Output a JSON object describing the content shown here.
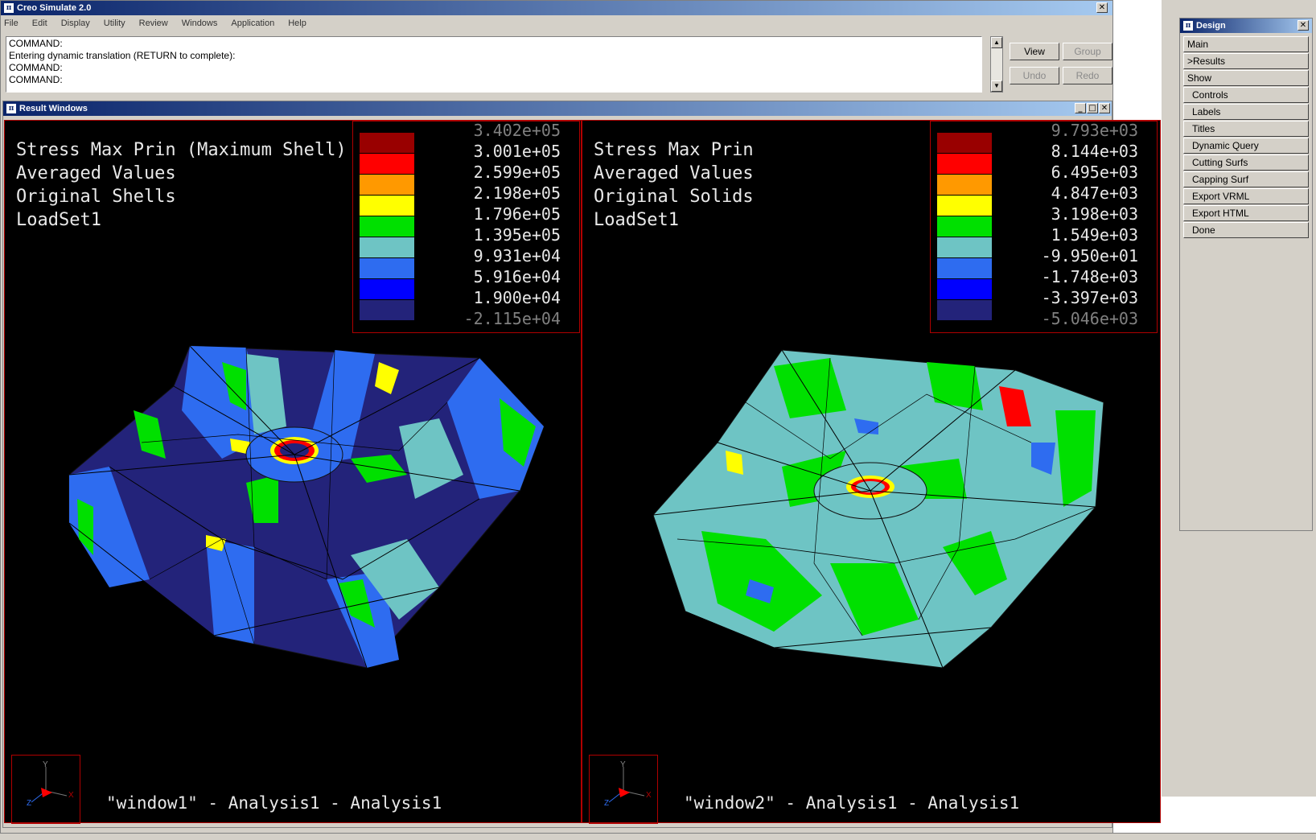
{
  "app": {
    "title": "Creo Simulate 2.0",
    "close_glyph": "✕"
  },
  "menu": [
    "File",
    "Edit",
    "Display",
    "Utility",
    "Review",
    "Windows",
    "Application",
    "Help"
  ],
  "command_lines": [
    "COMMAND:",
    "Entering dynamic translation (RETURN to complete):",
    "COMMAND:",
    "COMMAND:"
  ],
  "buttons": {
    "view": "View",
    "group": "Group",
    "undo": "Undo",
    "redo": "Redo"
  },
  "result_window": {
    "title": "Result Windows",
    "min_glyph": "_",
    "max_glyph": "□",
    "close_glyph": "✕"
  },
  "viewports": [
    {
      "labels": [
        "Stress Max Prin (Maximum Shell)",
        "Averaged Values",
        "Original Shells",
        "LoadSet1"
      ],
      "legend_values": [
        "3.402e+05",
        "3.001e+05",
        "2.599e+05",
        "2.198e+05",
        "1.796e+05",
        "1.395e+05",
        "9.931e+04",
        "5.916e+04",
        "1.900e+04",
        "-2.115e+04"
      ],
      "footer": "\"window1\" - Analysis1 - Analysis1",
      "axis_letters": {
        "y": "Y",
        "z": "Z",
        "x": "X"
      }
    },
    {
      "labels": [
        "Stress Max Prin",
        "Averaged Values",
        "Original Solids",
        "LoadSet1"
      ],
      "legend_values": [
        "9.793e+03",
        "8.144e+03",
        "6.495e+03",
        "4.847e+03",
        "3.198e+03",
        "1.549e+03",
        "-9.950e+01",
        "-1.748e+03",
        "-3.397e+03",
        "-5.046e+03"
      ],
      "footer": "\"window2\" - Analysis1 - Analysis1",
      "axis_letters": {
        "y": "Y",
        "z": "Z",
        "x": "X"
      }
    }
  ],
  "legend_colors": [
    "#990000",
    "#ff0000",
    "#ff9900",
    "#ffff00",
    "#00e000",
    "#6ec4c4",
    "#2e6cf0",
    "#0000ff",
    "#23237a"
  ],
  "design_panel": {
    "title": "Design",
    "close_glyph": "✕",
    "items": [
      "Main",
      ">Results",
      "Show",
      "Controls",
      "Labels",
      "Titles",
      "Dynamic Query",
      "Cutting Surfs",
      "Capping Surf",
      "Export VRML",
      "Export HTML",
      "Done"
    ]
  }
}
